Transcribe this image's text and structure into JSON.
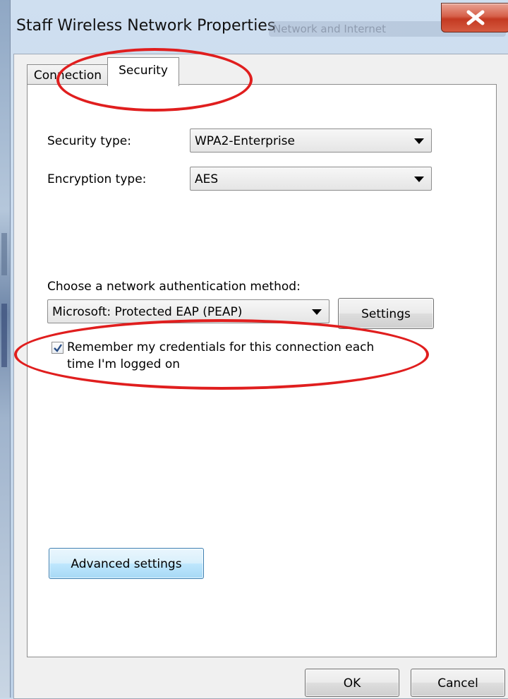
{
  "window": {
    "title": "Staff Wireless Network Properties",
    "background_breadcrumb": "Network and Internet"
  },
  "tabs": [
    {
      "label": "Connection",
      "selected": false
    },
    {
      "label": "Security",
      "selected": true
    }
  ],
  "security_type": {
    "label": "Security type:",
    "value": "WPA2-Enterprise"
  },
  "encryption_type": {
    "label": "Encryption type:",
    "value": "AES"
  },
  "auth": {
    "label": "Choose a network authentication method:",
    "method": "Microsoft: Protected EAP (PEAP)",
    "settings_button": "Settings"
  },
  "remember_credentials": {
    "checked": true,
    "line1": "Remember my credentials for this connection each",
    "line2": "time I'm logged on"
  },
  "advanced_button": "Advanced settings",
  "footer": {
    "ok": "OK",
    "cancel": "Cancel"
  },
  "colors": {
    "annotation": "#e01e1e",
    "close_button": "#c43a22"
  }
}
